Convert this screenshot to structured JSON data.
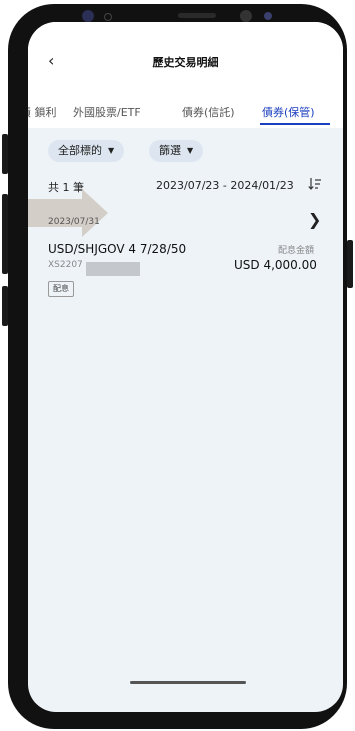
{
  "header": {
    "title": "歷史交易明細",
    "back_icon": "chevron-left-icon"
  },
  "tabs": [
    {
      "label": "債 鎖利"
    },
    {
      "label": "外國股票/ETF"
    },
    {
      "label": "債券(信託)"
    },
    {
      "label": "債券(保管)",
      "active": true
    }
  ],
  "filters": {
    "all_label": "全部標的",
    "filter_label": "篩選"
  },
  "summary": {
    "count": "共 1 筆",
    "date_range": "2023/07/23 - 2024/01/23"
  },
  "record": {
    "date": "2023/07/31",
    "name": "USD/SHJGOV 4 7/28/50",
    "code": "XS2207",
    "amount_label": "配息金額",
    "amount": "USD 4,000.00",
    "tag": "配息"
  },
  "colors": {
    "accent": "#1a3fbf",
    "screen_bg": "#eef3f8",
    "chip_bg": "#dde6f0"
  }
}
